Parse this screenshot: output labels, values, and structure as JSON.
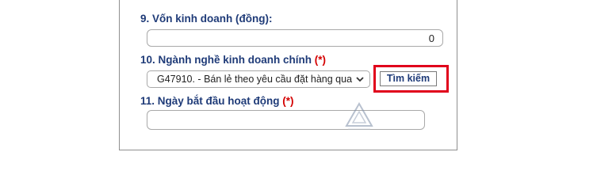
{
  "form": {
    "capital": {
      "label": "9. Vốn kinh doanh (đồng):",
      "value": "0"
    },
    "industry": {
      "label": "10. Ngành nghề kinh doanh chính",
      "required_mark": "(*)",
      "selected_value": "G47910. - Bán lẻ theo yêu cầu đặt hàng qua",
      "search_button_label": "Tìm kiếm"
    },
    "start_date": {
      "label": "11. Ngày bắt đầu hoạt động",
      "required_mark": "(*)",
      "value": ""
    }
  },
  "colors": {
    "label": "#1f3b78",
    "required": "#d40000",
    "highlight": "#e0001b"
  },
  "icons": {
    "select_arrow": "chevron-down-icon",
    "watermark": "logo-watermark"
  }
}
